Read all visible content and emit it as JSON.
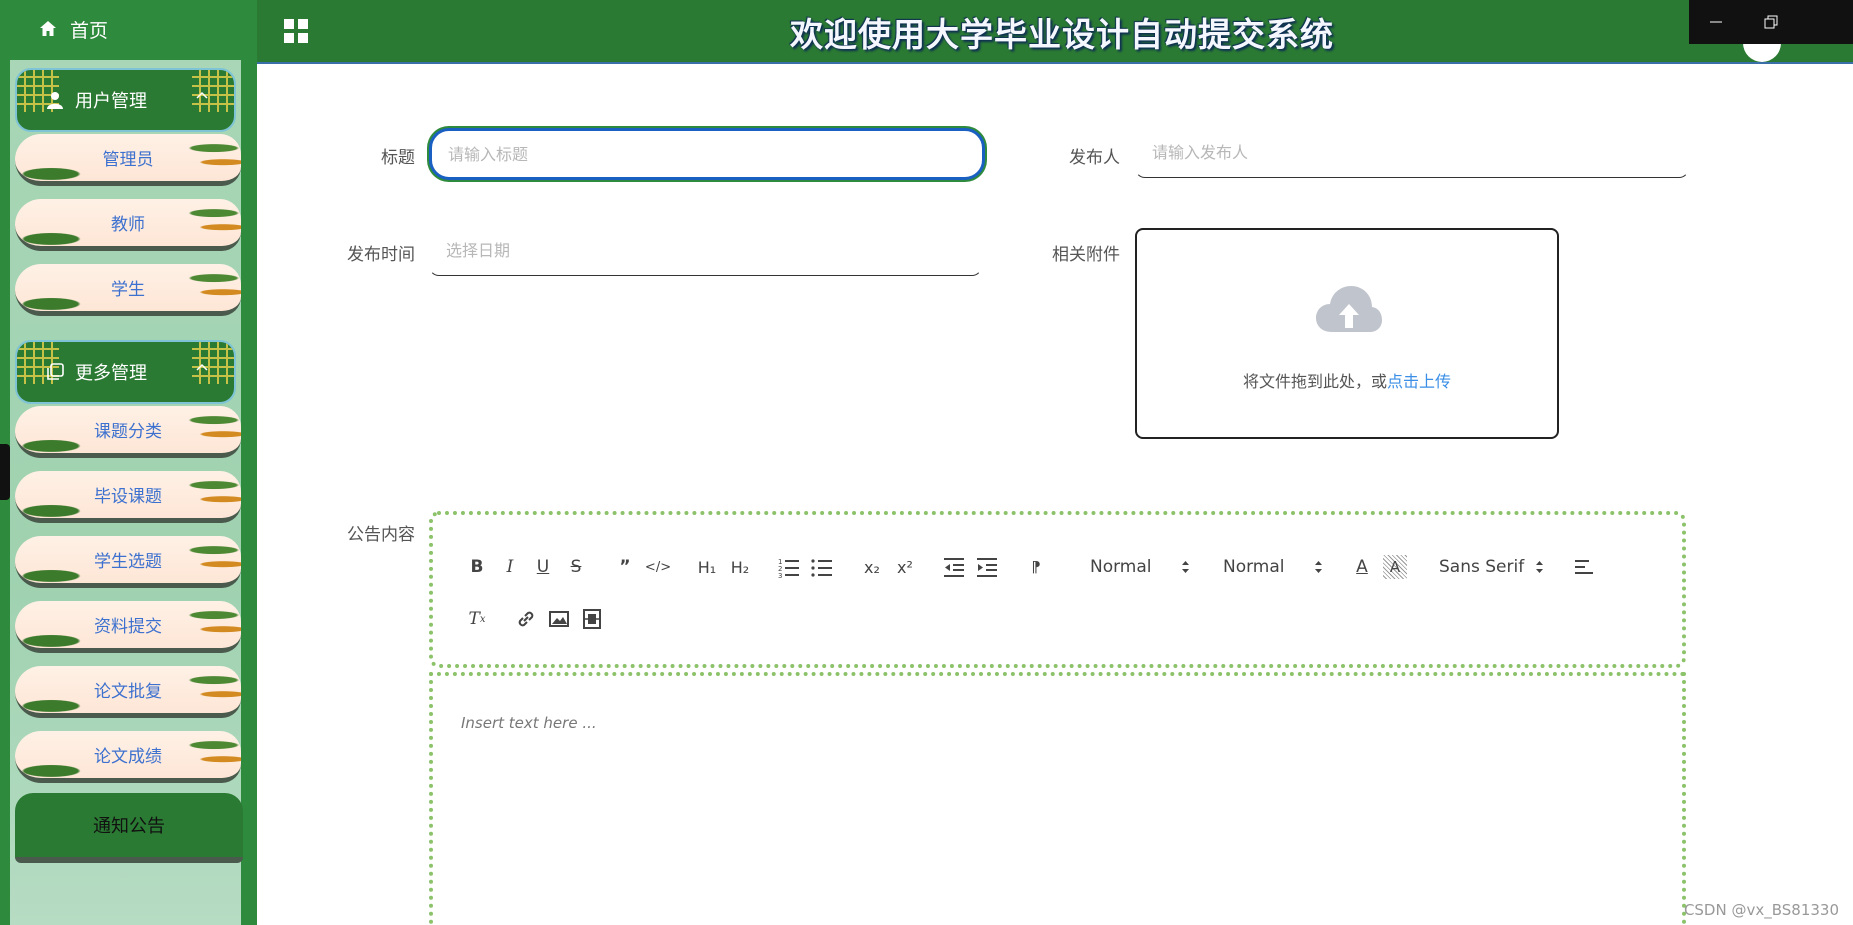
{
  "app": {
    "title": "欢迎使用大学毕业设计自动提交系统"
  },
  "sidebar": {
    "home_label": "首页",
    "groups": [
      {
        "label": "用户管理",
        "icon": "user-icon",
        "items": [
          "管理员",
          "教师",
          "学生"
        ]
      },
      {
        "label": "更多管理",
        "icon": "copy-icon",
        "items": [
          "课题分类",
          "毕设课题",
          "学生选题",
          "资料提交",
          "论文批复",
          "论文成绩"
        ]
      }
    ],
    "active_item": "通知公告"
  },
  "form": {
    "title_label": "标题",
    "title_placeholder": "请输入标题",
    "publisher_label": "发布人",
    "publisher_placeholder": "请输入发布人",
    "date_label": "发布时间",
    "date_placeholder": "选择日期",
    "attachment_label": "相关附件",
    "upload_text": "将文件拖到此处，或",
    "upload_link": "点击上传",
    "content_label": "公告内容"
  },
  "editor": {
    "placeholder": "Insert text here ...",
    "header_select": "Normal",
    "size_select": "Normal",
    "font_select": "Sans Serif",
    "buttons": [
      "bold",
      "italic",
      "underline",
      "strike",
      "blockquote",
      "code-block",
      "h1",
      "h2",
      "ordered-list",
      "bullet-list",
      "subscript",
      "superscript",
      "outdent",
      "indent",
      "direction",
      "color",
      "background",
      "align",
      "clean",
      "link",
      "image",
      "video"
    ]
  },
  "watermark": "CSDN @vx_BS81330",
  "colors": {
    "sidebar_green": "#2e8a3c",
    "header_green": "#2b7a33",
    "focus_blue": "#1a5fc2",
    "link_blue": "#3a8ee6",
    "vine_green": "#8cc26a"
  }
}
